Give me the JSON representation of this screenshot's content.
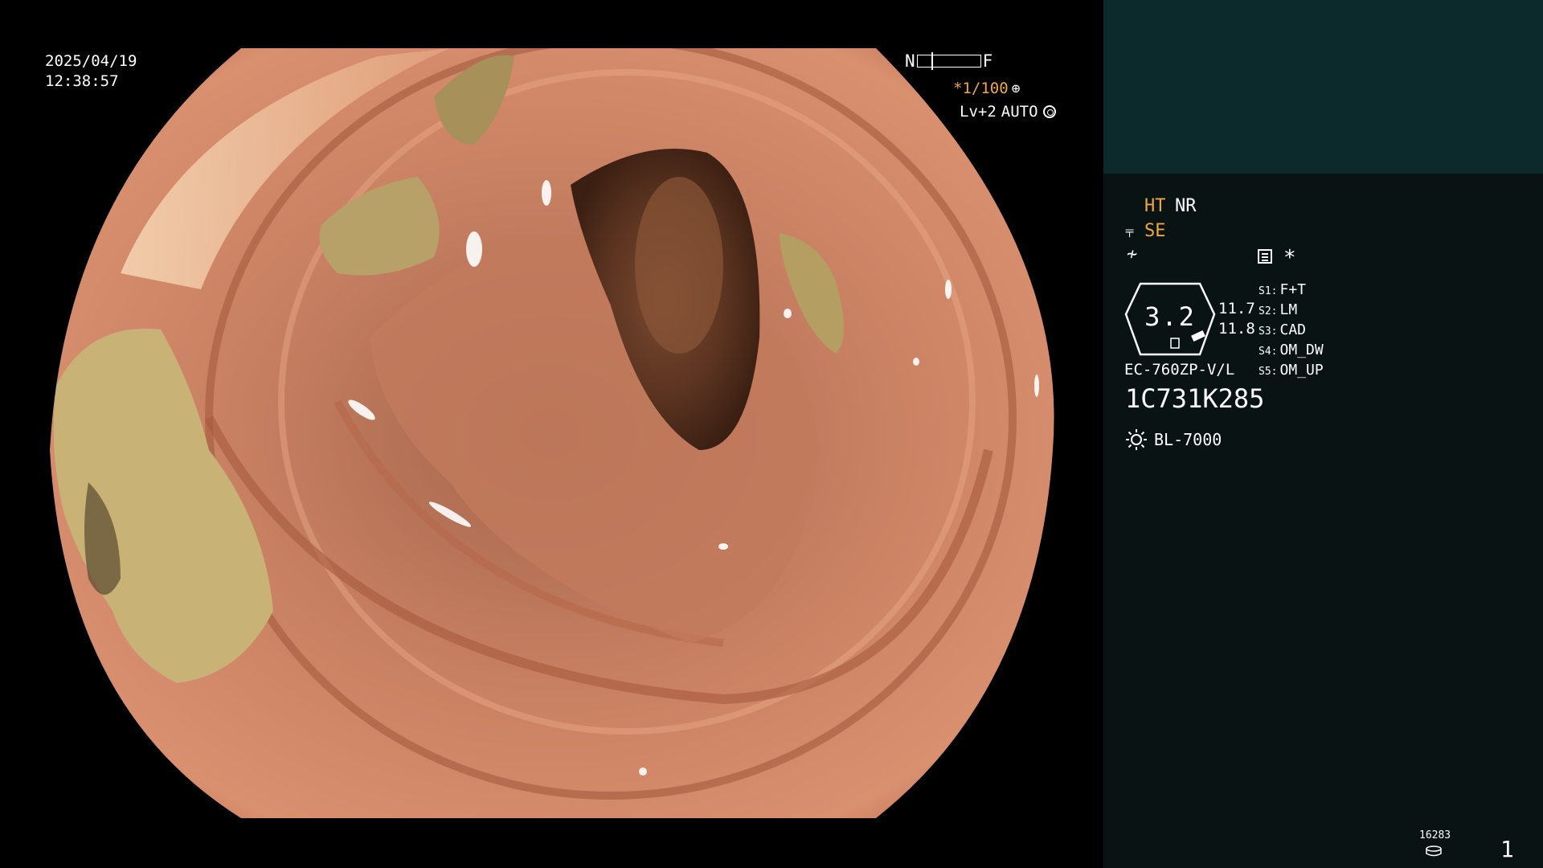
{
  "overlay": {
    "date": "2025/04/19",
    "time": "12:38:57",
    "nf_near": "N",
    "nf_far": "F",
    "shutter": "*1/100",
    "shutter_icon": "aperture-icon",
    "iris_level": "Lv+2",
    "iris_mode": "AUTO",
    "iris_icon": "iris-icon"
  },
  "panel": {
    "ht_label": "HT",
    "nr_label": "NR",
    "se_icon": "structure-enhancement-icon",
    "se_label": "SE",
    "freeze_icon": "freeze-icon",
    "star_label": "*",
    "zoom": "3.2",
    "dist_top": "11.7",
    "dist_bottom": "11.8",
    "switches": [
      {
        "key": "S1:",
        "value": "F+T"
      },
      {
        "key": "S2:",
        "value": "LM"
      },
      {
        "key": "S3:",
        "value": "CAD"
      },
      {
        "key": "S4:",
        "value": "OM_DW"
      },
      {
        "key": "S5:",
        "value": "OM_UP"
      }
    ],
    "scope_model": "EC-760ZP-V/L",
    "serial": "1C731K285",
    "light_source": "BL-7000",
    "counter": "16283",
    "page": "1"
  },
  "colors": {
    "accent_orange": "#f0a73d",
    "panel_bg": "#091314",
    "panel_top_bg": "#0c2a2c"
  }
}
